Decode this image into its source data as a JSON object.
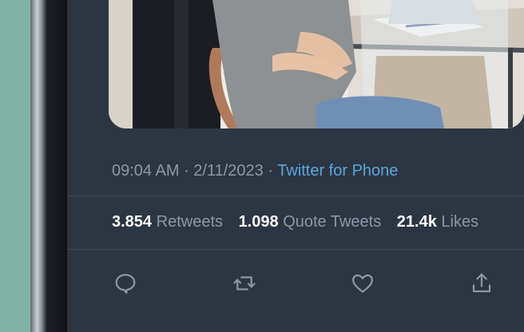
{
  "tweet": {
    "time": "09:04 AM",
    "separator": " · ",
    "date": "2/11/2023",
    "source": "Twitter for Phone"
  },
  "stats": {
    "retweets": {
      "value": "3.854",
      "label": "Retweets"
    },
    "quotes": {
      "value": "1.098",
      "label": "Quote Tweets"
    },
    "likes": {
      "value": "21.4k",
      "label": "Likes"
    }
  },
  "actions": [
    {
      "icon": "reply-icon"
    },
    {
      "icon": "retweet-icon"
    },
    {
      "icon": "like-icon"
    },
    {
      "icon": "share-icon"
    }
  ],
  "colors": {
    "background": "#2c3542",
    "muted_text": "#8b97a5",
    "link": "#5aa6dd",
    "emphasis": "#ffffff"
  }
}
